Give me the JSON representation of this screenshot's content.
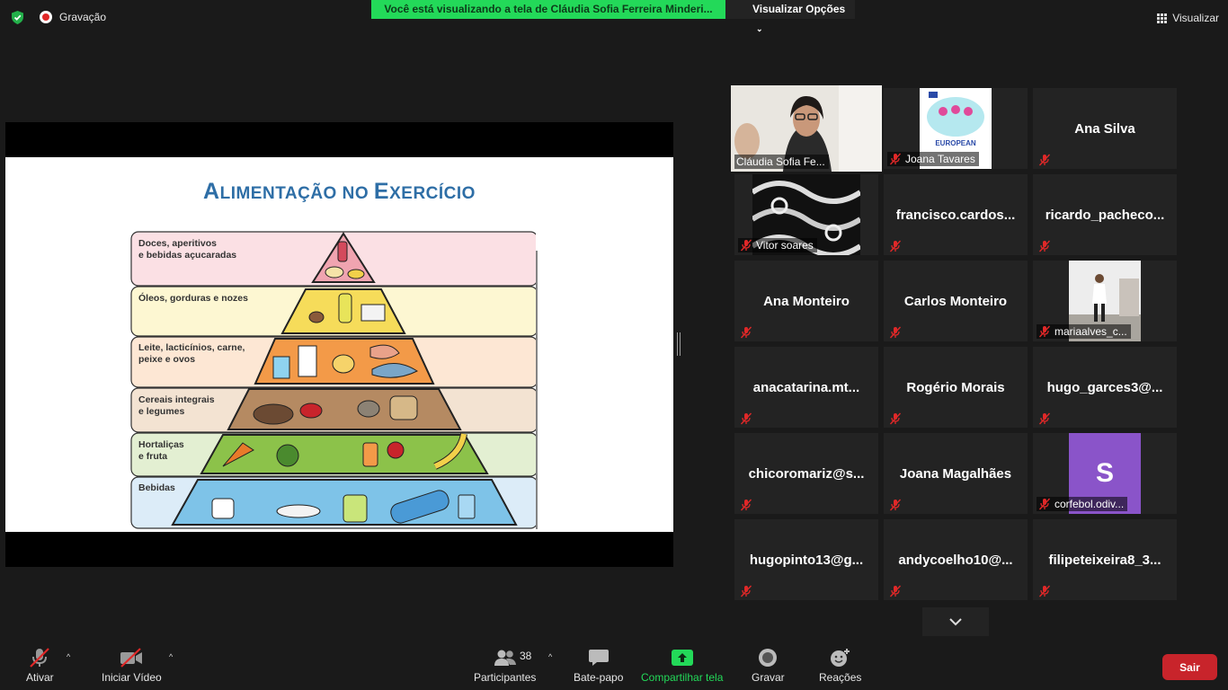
{
  "top": {
    "recording_label": "Gravação",
    "share_banner": "Você está visualizando a tela de Cláudia Sofia Ferreira Minderi...",
    "view_options": "Visualizar Opções",
    "view": "Visualizar"
  },
  "slide": {
    "title_cap1": "A",
    "title_rest1": "LIMENTAÇÃO NO ",
    "title_cap2": "E",
    "title_rest2": "XERCÍCIO",
    "levels": [
      {
        "line1": "Doces, aperitivos",
        "line2": "e bebidas açucaradas"
      },
      {
        "line1": "Óleos, gorduras e nozes",
        "line2": ""
      },
      {
        "line1": "Leite, lacticínios, carne,",
        "line2": "peixe e ovos"
      },
      {
        "line1": "Cereais integrais",
        "line2": "e legumes"
      },
      {
        "line1": "Hortaliças",
        "line2": "e fruta"
      },
      {
        "line1": "Bebidas",
        "line2": ""
      }
    ]
  },
  "participants_tiles": [
    {
      "name": "Cláudia Sofia Fe...",
      "type": "video",
      "active": true
    },
    {
      "name": "Joana Tavares",
      "type": "image",
      "image_text": "EUROPEAN"
    },
    {
      "name": "Ana Silva",
      "type": "text"
    },
    {
      "name": "Vitor soares",
      "type": "image"
    },
    {
      "name": "francisco.cardos...",
      "type": "text"
    },
    {
      "name": "ricardo_pacheco...",
      "type": "text"
    },
    {
      "name": "Ana Monteiro",
      "type": "text"
    },
    {
      "name": "Carlos Monteiro",
      "type": "text"
    },
    {
      "name": "mariaalves_c...",
      "type": "image"
    },
    {
      "name": "anacatarina.mt...",
      "type": "text"
    },
    {
      "name": "Rogério Morais",
      "type": "text"
    },
    {
      "name": "hugo_garces3@...",
      "type": "text"
    },
    {
      "name": "chicoromariz@s...",
      "type": "text"
    },
    {
      "name": "Joana Magalhães",
      "type": "text"
    },
    {
      "name": "corfebol.odiv...",
      "type": "avatar",
      "avatar_letter": "S",
      "avatar_color": "#8a54c9"
    },
    {
      "name": "hugopinto13@g...",
      "type": "text"
    },
    {
      "name": "andycoelho10@...",
      "type": "text"
    },
    {
      "name": "filipeteixeira8_3...",
      "type": "text"
    }
  ],
  "toolbar": {
    "unmute": "Ativar",
    "start_video": "Iniciar Vídeo",
    "participants": "Participantes",
    "participants_count": "38",
    "chat": "Bate-papo",
    "share_screen": "Compartilhar tela",
    "record": "Gravar",
    "reactions": "Reações",
    "leave": "Sair"
  },
  "colors": {
    "share_banner": "#23d959",
    "active_speaker": "#c8ed5b",
    "leave": "#c8242b",
    "mute_red": "#e02828"
  }
}
